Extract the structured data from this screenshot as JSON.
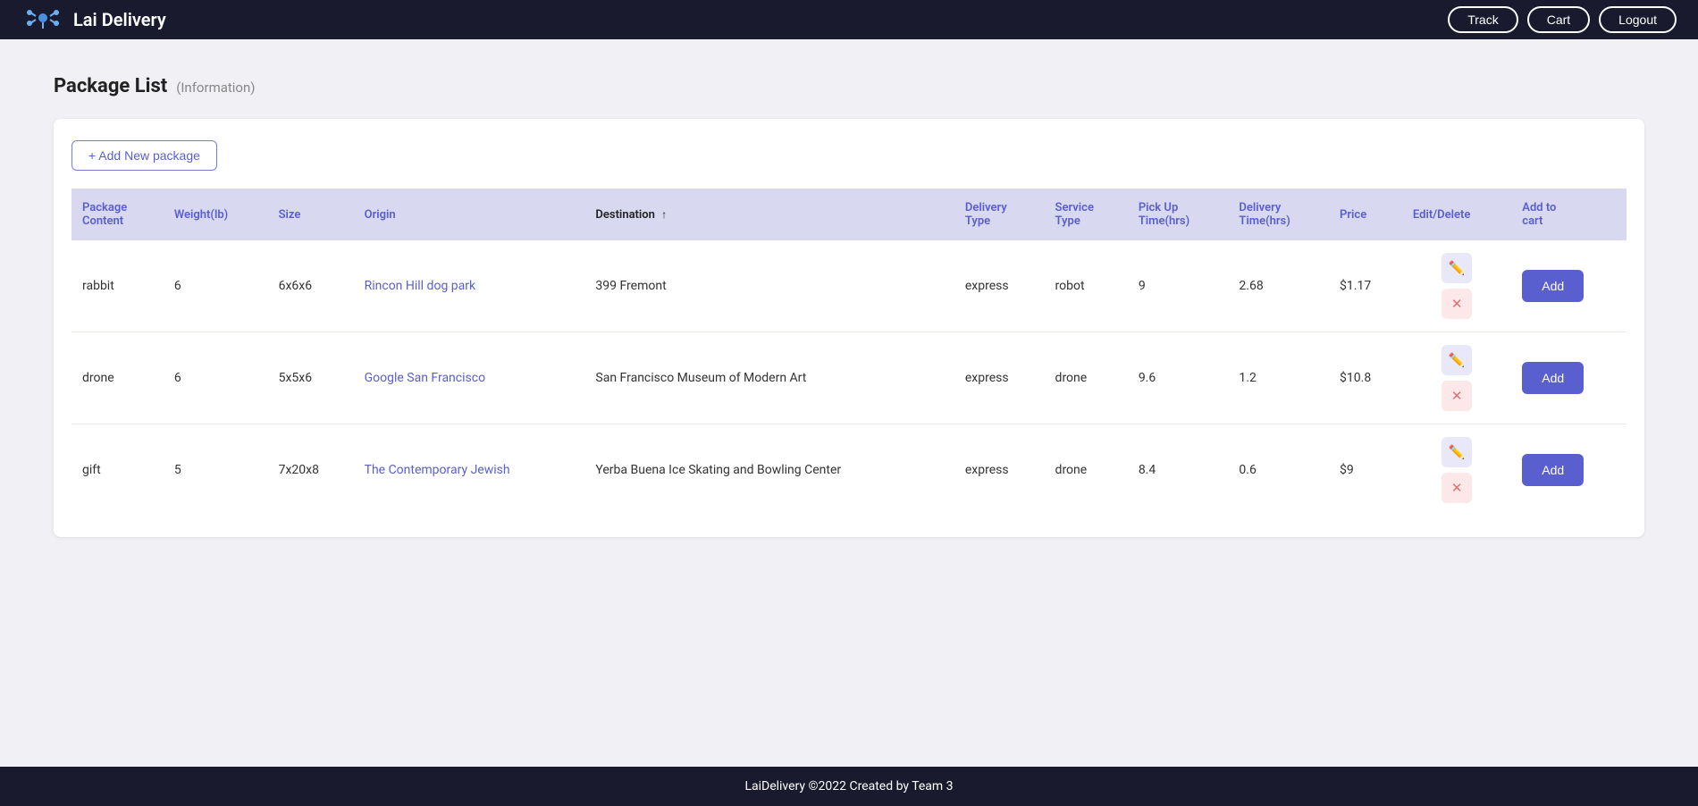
{
  "app": {
    "title": "Lai Delivery",
    "footer_text": "LaiDelivery ©2022 Created by Team 3"
  },
  "navbar": {
    "track_label": "Track",
    "cart_label": "Cart",
    "logout_label": "Logout"
  },
  "page": {
    "title": "Package List",
    "subtitle": "(Information)"
  },
  "table": {
    "add_button_label": "+ Add New package",
    "columns": [
      {
        "key": "content",
        "label": "Package Content",
        "sorted": false
      },
      {
        "key": "weight",
        "label": "Weight(lb)",
        "sorted": false
      },
      {
        "key": "size",
        "label": "Size",
        "sorted": false
      },
      {
        "key": "origin",
        "label": "Origin",
        "sorted": false
      },
      {
        "key": "destination",
        "label": "Destination",
        "sorted": true
      },
      {
        "key": "delivery_type",
        "label": "Delivery Type",
        "sorted": false
      },
      {
        "key": "service_type",
        "label": "Service Type",
        "sorted": false
      },
      {
        "key": "pickup_time",
        "label": "Pick Up Time(hrs)",
        "sorted": false
      },
      {
        "key": "delivery_time",
        "label": "Delivery Time(hrs)",
        "sorted": false
      },
      {
        "key": "price",
        "label": "Price",
        "sorted": false
      },
      {
        "key": "edit_delete",
        "label": "Edit/Delete",
        "sorted": false
      },
      {
        "key": "add_to_cart",
        "label": "Add to cart",
        "sorted": false
      }
    ],
    "rows": [
      {
        "content": "rabbit",
        "weight": "6",
        "size": "6x6x6",
        "origin": "Rincon Hill dog park",
        "destination": "399 Fremont",
        "delivery_type": "express",
        "service_type": "robot",
        "pickup_time": "9",
        "delivery_time": "2.68",
        "price": "$1.17",
        "add_cart_label": "Add"
      },
      {
        "content": "drone",
        "weight": "6",
        "size": "5x5x6",
        "origin": "Google San Francisco",
        "destination": "San Francisco Museum of Modern Art",
        "delivery_type": "express",
        "service_type": "drone",
        "pickup_time": "9.6",
        "delivery_time": "1.2",
        "price": "$10.8",
        "add_cart_label": "Add"
      },
      {
        "content": "gift",
        "weight": "5",
        "size": "7x20x8",
        "origin": "The Contemporary Jewish",
        "destination": "Yerba Buena Ice Skating and Bowling Center",
        "delivery_type": "express",
        "service_type": "drone",
        "pickup_time": "8.4",
        "delivery_time": "0.6",
        "price": "$9",
        "add_cart_label": "Add"
      }
    ]
  }
}
